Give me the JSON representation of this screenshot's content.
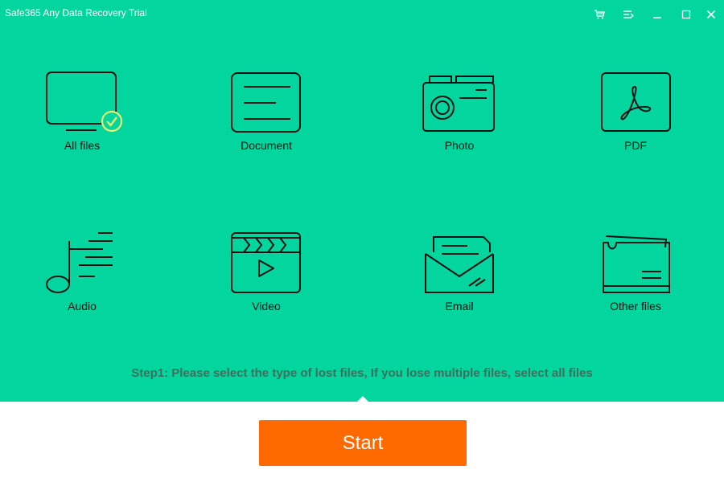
{
  "window": {
    "title": "Safe365 Any Data Recovery Trial"
  },
  "titlebar_buttons": [
    {
      "name": "cart-icon"
    },
    {
      "name": "menu-icon"
    },
    {
      "name": "minimize-icon"
    },
    {
      "name": "maximize-icon"
    },
    {
      "name": "close-icon"
    }
  ],
  "file_types": [
    {
      "label": "All files",
      "icon": "monitor-icon",
      "selected": true
    },
    {
      "label": "Document",
      "icon": "document-icon",
      "selected": false
    },
    {
      "label": "Photo",
      "icon": "camera-icon",
      "selected": false
    },
    {
      "label": "PDF",
      "icon": "pdf-icon",
      "selected": false
    },
    {
      "label": "Audio",
      "icon": "music-note-icon",
      "selected": false
    },
    {
      "label": "Video",
      "icon": "clapperboard-icon",
      "selected": false
    },
    {
      "label": "Email",
      "icon": "envelope-icon",
      "selected": false
    },
    {
      "label": "Other files",
      "icon": "folder-icon",
      "selected": false
    }
  ],
  "step_text": "Step1: Please select the type of lost files, If you lose multiple files, select all files",
  "start_button": {
    "label": "Start"
  },
  "colors": {
    "primary_green": "#03d59f",
    "start_orange": "#ff6a00",
    "checkmark": "#e8f46a",
    "step_text": "#3d6f5c"
  }
}
